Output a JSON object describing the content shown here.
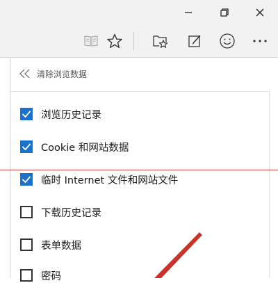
{
  "window": {
    "minimize_icon": "minimize-icon",
    "restore_icon": "restore-icon",
    "close_icon": "close-icon"
  },
  "toolbar": {
    "icons": [
      "reading-view-icon",
      "favorite-star-icon",
      "favorites-hub-icon",
      "web-note-icon",
      "feedback-smiley-icon",
      "more-icon"
    ]
  },
  "panel": {
    "title": "清除浏览数据",
    "back_icon": "double-chevron-left-icon"
  },
  "options": [
    {
      "label": "浏览历史记录",
      "checked": true
    },
    {
      "label": "Cookie 和网站数据",
      "checked": true
    },
    {
      "label": "临时 Internet 文件和网站文件",
      "checked": true
    },
    {
      "label": "下载历史记录",
      "checked": false
    },
    {
      "label": "表单数据",
      "checked": false
    },
    {
      "label": "密码",
      "checked": false
    }
  ],
  "colors": {
    "checkbox_accent": "#1a73c9",
    "annotation_red": "#c8332b"
  }
}
